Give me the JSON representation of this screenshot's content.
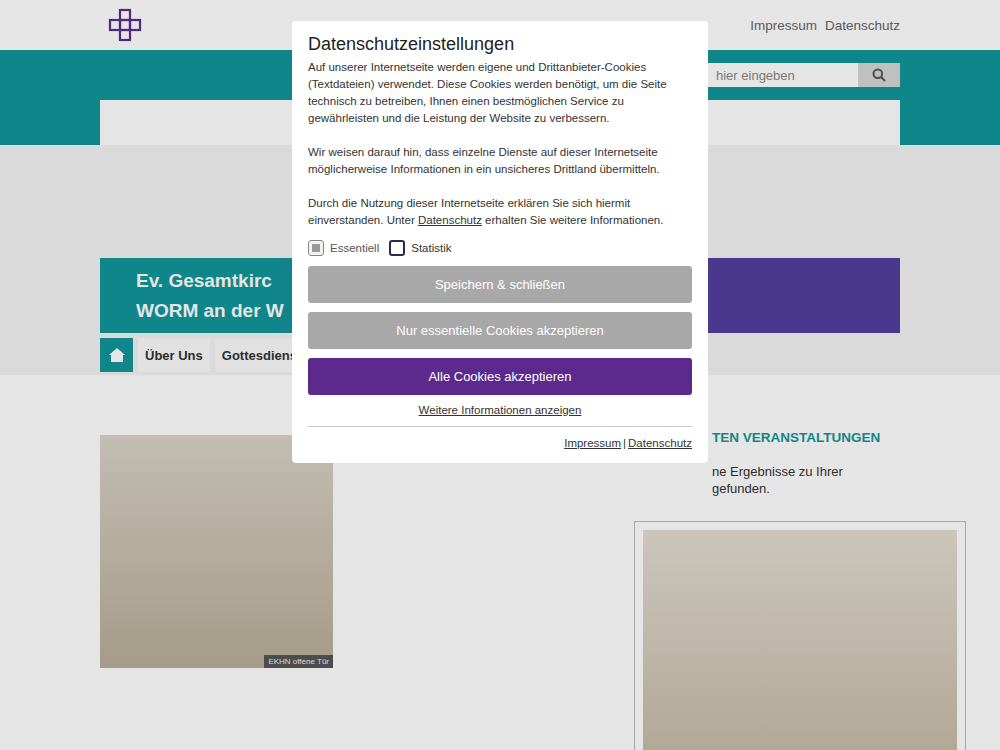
{
  "header": {
    "links": [
      "Impressum",
      "Datenschutz"
    ]
  },
  "search": {
    "placeholder": "hier eingeben"
  },
  "banner": {
    "lines": [
      "Ev. Gesamtkirc",
      "WORM an der W"
    ]
  },
  "nav": {
    "home": {
      "selected": true
    },
    "items": [
      {
        "label": "Über Uns",
        "selected": false
      },
      {
        "label": "Gottesdiens",
        "selected": false
      }
    ]
  },
  "events": {
    "heading": "TEN VERANSTALTUNGEN",
    "lines": [
      "ne Ergebnisse zu Ihrer",
      "gefunden."
    ]
  },
  "photo_credit": "EKHN offene Tür",
  "dialog": {
    "title": "Datenschutzeinstellungen",
    "paragraphs": [
      "Auf unserer Internetseite werden eigene und Drittanbieter-Cookies (Textdateien) verwendet. Diese Cookies werden benötigt, um die Seite technisch zu betreiben, Ihnen einen bestmöglichen Service zu gewährleisten und die Leistung der Website zu verbessern.",
      "Wir weisen darauf hin, dass einzelne Dienste auf dieser Internetseite möglicherweise Informationen in ein unsicheres Drittland übermitteln."
    ],
    "consent": {
      "before": "Durch die Nutzung dieser Internetseite erklären Sie sich hiermit einverstanden. Unter ",
      "link": "Datenschutz",
      "after": " erhalten Sie weitere Informationen."
    },
    "checkboxes": [
      {
        "label": "Essentiell",
        "checked": true,
        "disabled": true
      },
      {
        "label": "Statistik",
        "checked": false,
        "disabled": false
      }
    ],
    "buttons": [
      {
        "label": "Speichern & schließen",
        "kind": "secondary"
      },
      {
        "label": "Nur essentielle Cookies akzeptieren",
        "kind": "secondary"
      },
      {
        "label": "Alle Cookies akzeptieren",
        "kind": "primary"
      }
    ],
    "more_link": "Weitere Informationen anzeigen",
    "footer_links": [
      "Impressum",
      "Datenschutz"
    ],
    "separator": "|"
  }
}
